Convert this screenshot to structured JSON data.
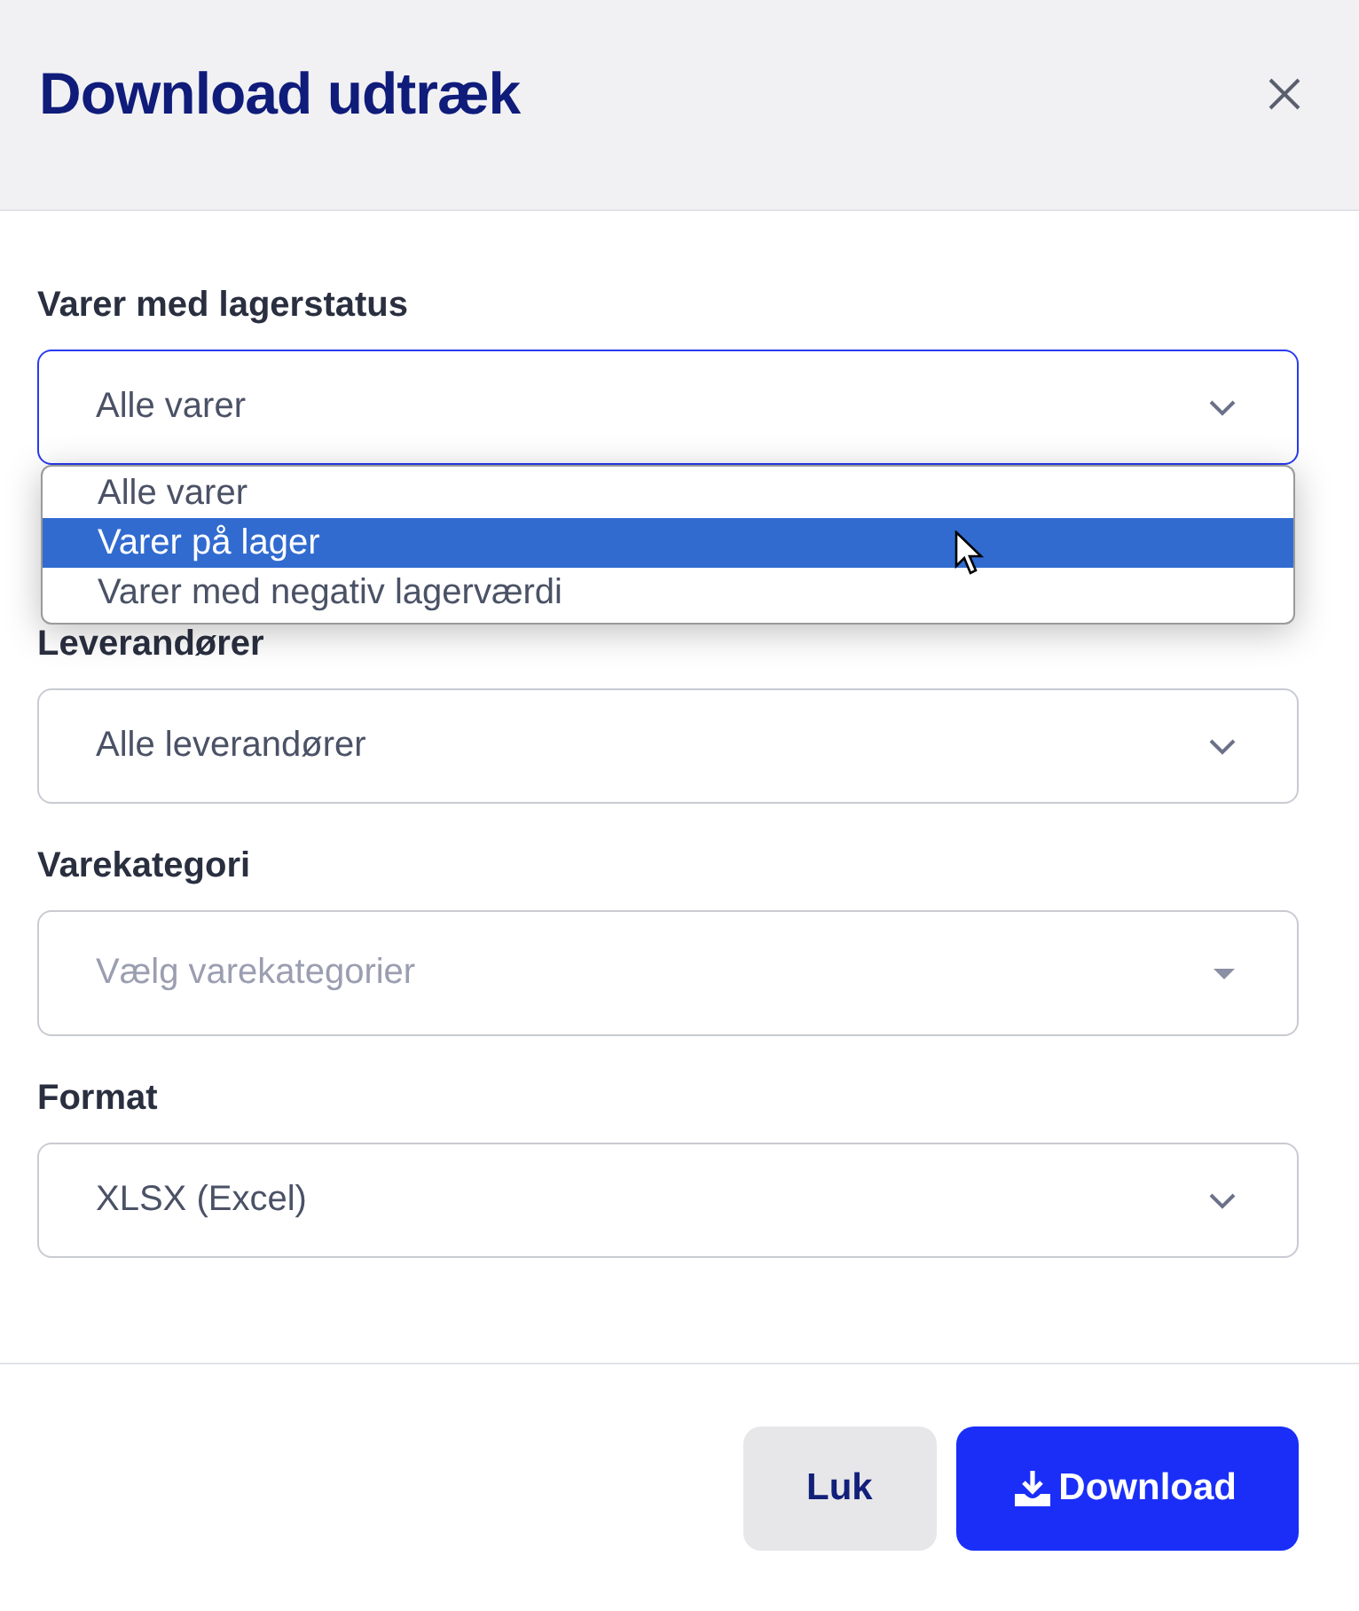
{
  "dialog": {
    "title": "Download udtræk"
  },
  "fields": [
    {
      "label": "Varer med lagerstatus",
      "kind": "select",
      "value": "Alle varer",
      "focused": true,
      "open": true,
      "options": [
        {
          "label": "Alle varer",
          "highlighted": false
        },
        {
          "label": "Varer på lager",
          "highlighted": true
        },
        {
          "label": "Varer med negativ lagerværdi",
          "highlighted": false
        }
      ]
    },
    {
      "label": "Leverandører",
      "kind": "select",
      "value": "Alle leverandører",
      "focused": false,
      "open": false
    },
    {
      "label": "Varekategori",
      "kind": "multiselect",
      "placeholder": "Vælg varekategorier",
      "focused": false,
      "open": false
    },
    {
      "label": "Format",
      "kind": "select",
      "value": "XLSX (Excel)",
      "focused": false,
      "open": false
    }
  ],
  "buttons": [
    {
      "label": "Luk",
      "kind": "secondary"
    },
    {
      "label": "Download",
      "kind": "primary"
    }
  ]
}
